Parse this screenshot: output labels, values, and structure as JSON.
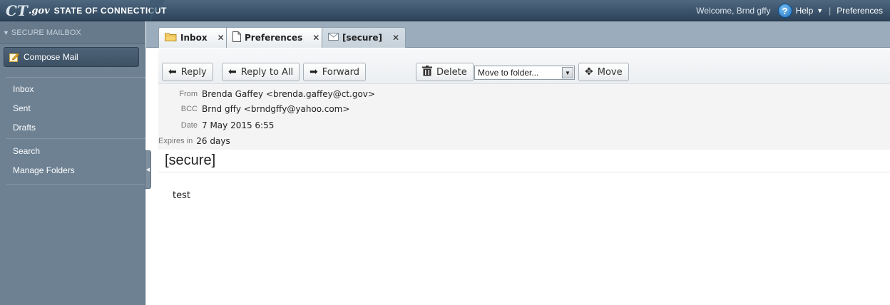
{
  "topbar": {
    "logo_ct": "CT",
    "logo_gov": ".gov",
    "logo_state": "STATE OF CONNECTICUT",
    "welcome": "Welcome, Brnd gffy",
    "help_label": "Help",
    "preferences_label": "Preferences"
  },
  "sidebar": {
    "header": "SECURE MAILBOX",
    "compose_label": "Compose Mail",
    "items": [
      {
        "label": "Inbox"
      },
      {
        "label": "Sent"
      },
      {
        "label": "Drafts"
      },
      {
        "label": "Search"
      },
      {
        "label": "Manage Folders"
      }
    ]
  },
  "tabs": [
    {
      "label": "Inbox",
      "icon": "folder-icon",
      "active": false
    },
    {
      "label": "Preferences",
      "icon": "document-icon",
      "active": false
    },
    {
      "label": "[secure]",
      "icon": "envelope-icon",
      "active": true
    }
  ],
  "toolbar": {
    "reply_label": "Reply",
    "reply_all_label": "Reply to All",
    "forward_label": "Forward",
    "delete_label": "Delete",
    "move_select_value": "Move to folder...",
    "move_label": "Move"
  },
  "message": {
    "from_label": "From",
    "from_value": "Brenda Gaffey <brenda.gaffey@ct.gov>",
    "bcc_label": "BCC",
    "bcc_value": "Brnd gffy <brndgffy@yahoo.com>",
    "date_label": "Date",
    "date_value": "7 May 2015 6:55",
    "expires_label": "Expires in",
    "expires_value": "26 days",
    "subject": "[secure]",
    "body": "test"
  },
  "colors": {
    "topbar": "#3a5268",
    "sidebar": "#6d8193",
    "tabbar": "#9badbd",
    "header_bg": "#f4f4f4"
  }
}
